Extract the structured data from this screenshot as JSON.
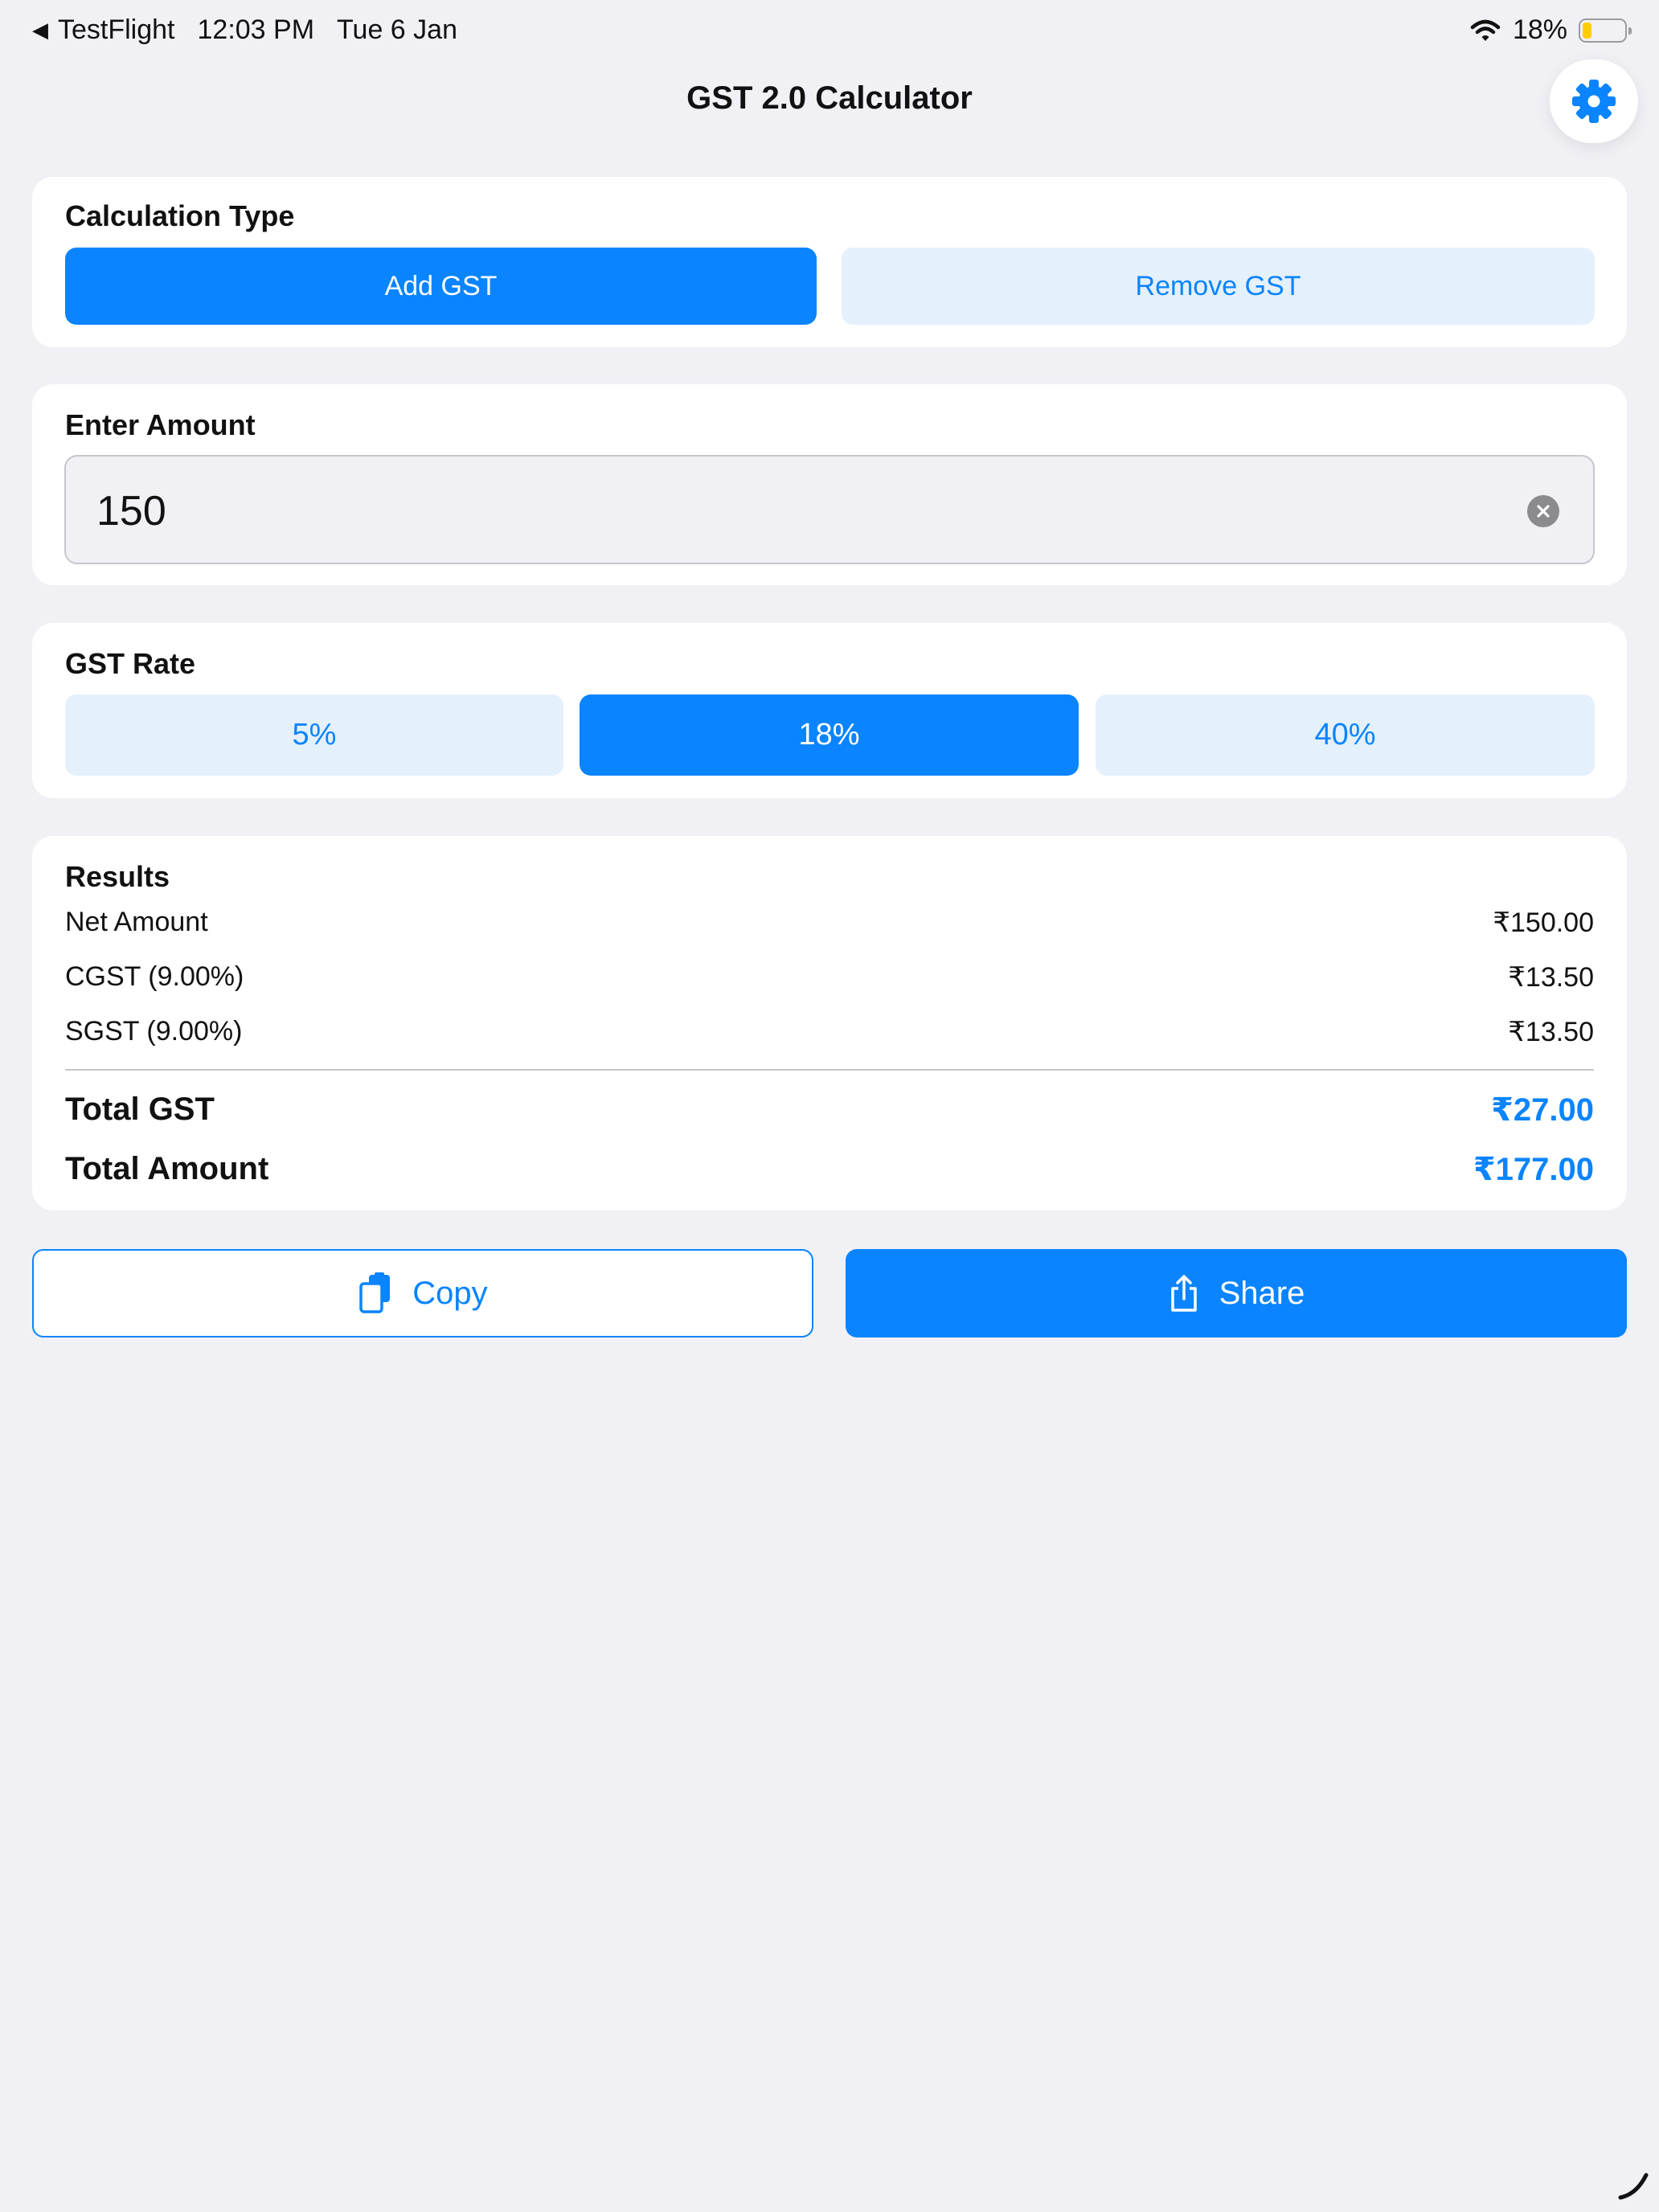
{
  "status_bar": {
    "back_app": "TestFlight",
    "time": "12:03 PM",
    "date": "Tue 6 Jan",
    "battery_percent": "18%",
    "battery_level": 0.18
  },
  "header": {
    "title": "GST 2.0 Calculator",
    "settings_icon": "gear-icon"
  },
  "calculation_type": {
    "label": "Calculation Type",
    "options": [
      "Add GST",
      "Remove GST"
    ],
    "selected": "Add GST"
  },
  "amount": {
    "label": "Enter Amount",
    "value": "150"
  },
  "gst_rate": {
    "label": "GST Rate",
    "options": [
      "5%",
      "18%",
      "40%"
    ],
    "selected": "18%"
  },
  "results": {
    "label": "Results",
    "rows": [
      {
        "label": "Net Amount",
        "value": "₹150.00"
      },
      {
        "label": "CGST (9.00%)",
        "value": "₹13.50"
      },
      {
        "label": "SGST (9.00%)",
        "value": "₹13.50"
      }
    ],
    "total_gst": {
      "label": "Total GST",
      "value": "₹27.00"
    },
    "total_amount": {
      "label": "Total Amount",
      "value": "₹177.00"
    }
  },
  "actions": {
    "copy_label": "Copy",
    "share_label": "Share"
  },
  "colors": {
    "accent": "#0a84ff",
    "background": "#f0f0f5",
    "inactive_segment": "#e4f0fc"
  }
}
